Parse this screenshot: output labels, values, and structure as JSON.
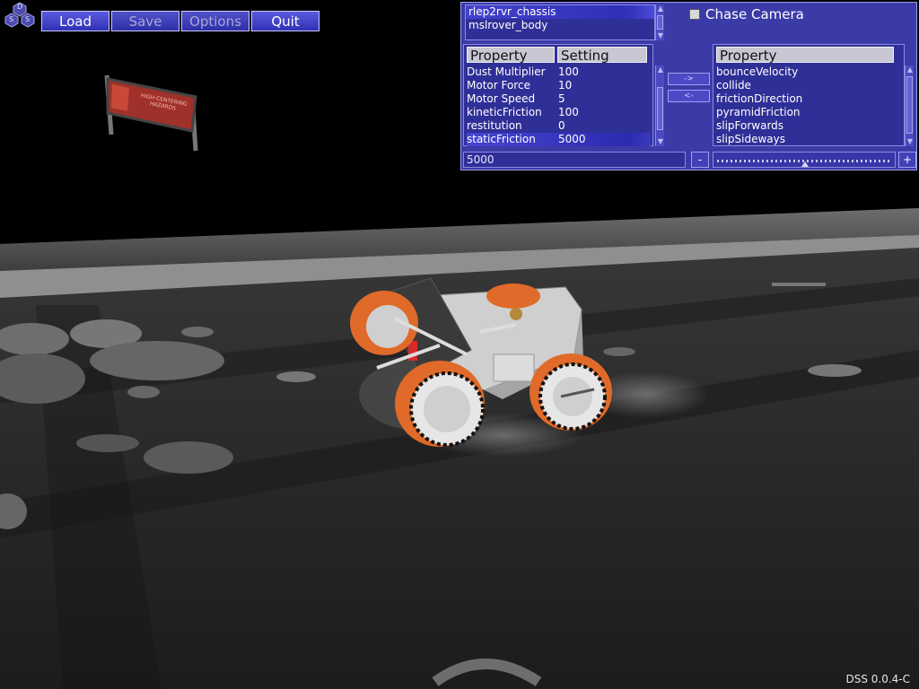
{
  "logo_letters": [
    "D",
    "S",
    "S"
  ],
  "toolbar": {
    "load": "Load",
    "save": "Save",
    "options": "Options",
    "quit": "Quit"
  },
  "sign_text": "HIGH-CENTERING HAZARDS",
  "panel": {
    "objects": [
      "rlep2rvr_chassis",
      "mslrover_body"
    ],
    "chase_camera": "Chase Camera",
    "left_table": {
      "col1": "Property",
      "col2": "Setting",
      "rows": [
        {
          "name": "Dust Multiplier",
          "value": "100"
        },
        {
          "name": "Motor Force",
          "value": "10"
        },
        {
          "name": "Motor Speed",
          "value": "5"
        },
        {
          "name": "kineticFriction",
          "value": "100"
        },
        {
          "name": "restitution",
          "value": "0"
        },
        {
          "name": "staticFriction",
          "value": "5000"
        }
      ]
    },
    "move_right": "->",
    "move_left": "<-",
    "right_table": {
      "col1": "Property",
      "rows": [
        "bounceVelocity",
        "collide",
        "frictionDirection",
        "pyramidFriction",
        "slipForwards",
        "slipSideways"
      ]
    },
    "value_input": "5000",
    "minus": "-",
    "plus": "+",
    "slider_fraction": 0.5
  },
  "version": "DSS 0.0.4-C",
  "colors": {
    "panel": "#3b3ba8",
    "button": "#4242c8",
    "wheel_orange": "#e06a2a"
  }
}
